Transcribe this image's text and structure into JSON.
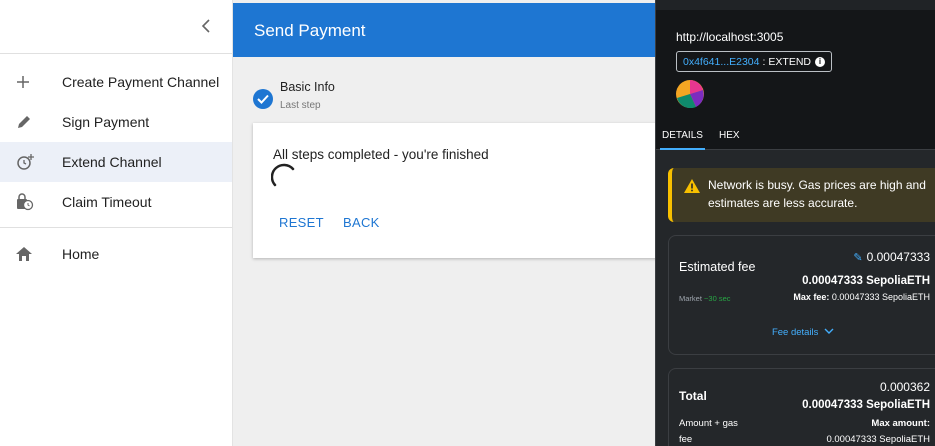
{
  "sidebar": {
    "items": [
      {
        "label": "Create Payment Channel",
        "icon": "plus-icon"
      },
      {
        "label": "Sign Payment",
        "icon": "pencil-icon"
      },
      {
        "label": "Extend Channel",
        "icon": "clock-add-icon"
      },
      {
        "label": "Claim Timeout",
        "icon": "lock-clock-icon"
      },
      {
        "label": "Home",
        "icon": "home-icon"
      }
    ]
  },
  "main": {
    "title": "Send Payment",
    "step": {
      "label": "Basic Info",
      "sublabel": "Last step"
    },
    "card": {
      "message": "All steps completed - you're finished",
      "reset": "RESET",
      "back": "BACK"
    }
  },
  "metamask": {
    "url": "http://localhost:3005",
    "address": "0x4f641...E2304",
    "action": "EXTEND",
    "tabs": {
      "details": "DETAILS",
      "hex": "HEX"
    },
    "warning_line1": "Network is busy. Gas prices are high and",
    "warning_line2": "estimates are less accurate.",
    "fee": {
      "label": "Estimated fee",
      "value": "0.00047333",
      "value_bold": "0.00047333 SepoliaETH",
      "market": "Market",
      "market_time": "~30 sec",
      "max_label": "Max fee:",
      "max_value": "0.00047333 SepoliaETH",
      "details_link": "Fee details"
    },
    "total": {
      "label": "Total",
      "value": "0.000362",
      "value_bold": "0.00047333 SepoliaETH",
      "sub_label": "Amount + gas",
      "sub_label2": "fee",
      "max_label": "Max amount:",
      "max_value": "0.00047333 SepoliaETH"
    },
    "colors": {
      "accent": "#43aefc",
      "warning": "#f8c000",
      "bg": "#24272a"
    }
  },
  "colors": {
    "primary": "#1e76d2"
  }
}
